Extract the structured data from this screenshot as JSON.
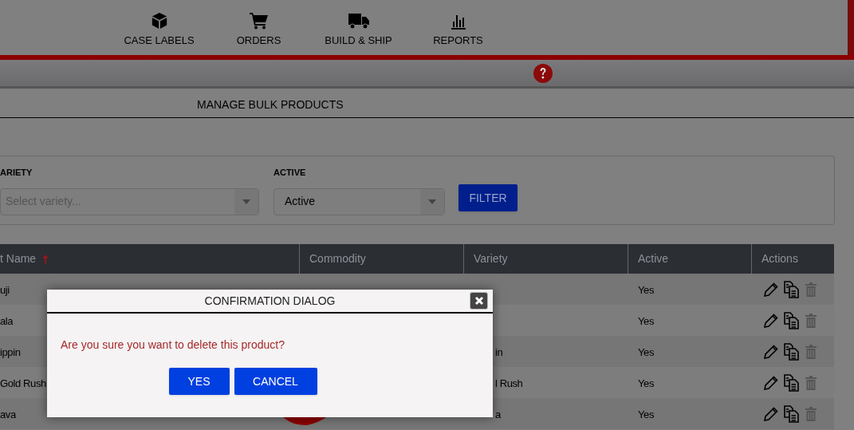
{
  "nav": [
    {
      "label": "CASE LABELS"
    },
    {
      "label": "ORDERS"
    },
    {
      "label": "BUILD & SHIP"
    },
    {
      "label": "REPORTS"
    }
  ],
  "page_title": "MANAGE BULK PRODUCTS",
  "filters": [
    {
      "label": "ARIETY",
      "placeholder": "Select variety..."
    },
    {
      "label": "ACTIVE",
      "value": "Active"
    }
  ],
  "filter_button": "FILTER",
  "table": {
    "columns": [
      {
        "label": "t Name",
        "sorted": true
      },
      {
        "label": "Commodity",
        "sorted": false
      },
      {
        "label": "Variety",
        "sorted": false
      },
      {
        "label": "Active",
        "sorted": false
      },
      {
        "label": "Actions",
        "sorted": false
      }
    ],
    "rows": [
      {
        "name": "uji",
        "active": "Yes"
      },
      {
        "name": "ala",
        "active": "Yes"
      },
      {
        "name": "ippin",
        "variety": "in",
        "active": "Yes"
      },
      {
        "name": "Gold Rush",
        "variety": "l Rush",
        "active": "Yes"
      },
      {
        "name": "ava",
        "variety": "a",
        "active": "Yes"
      }
    ]
  },
  "dialog": {
    "title": "CONFIRMATION DIALOG",
    "message": "Are you sure you want to delete this product?",
    "buttons": [
      "YES",
      "CANCEL"
    ]
  }
}
